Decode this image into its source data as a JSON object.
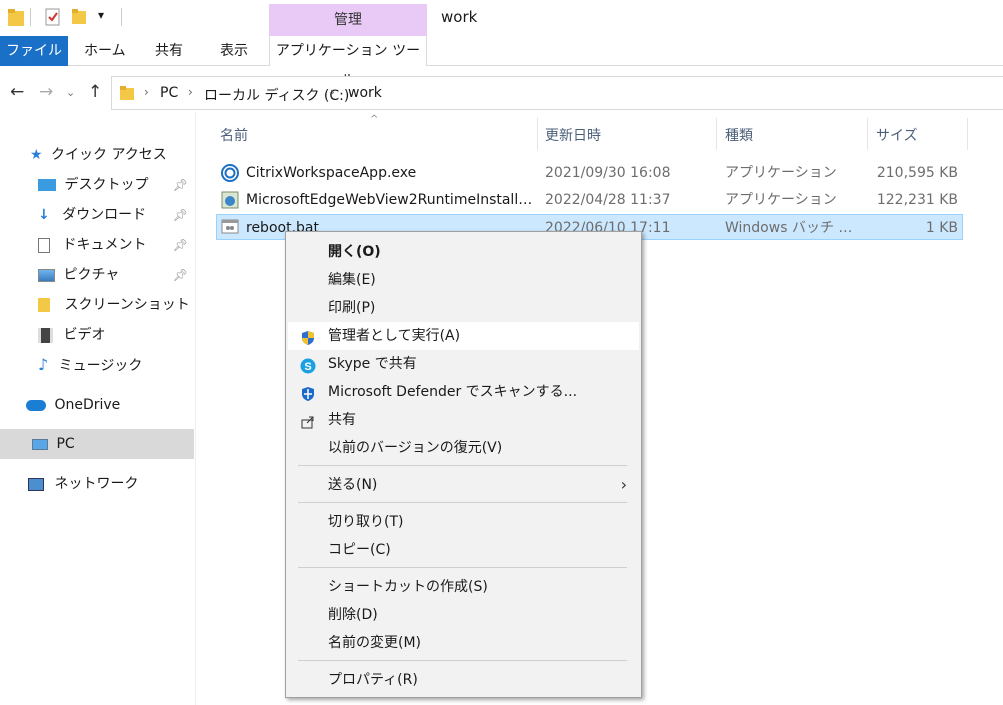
{
  "window": {
    "title": "work",
    "context_tab_header": "管理"
  },
  "ribbon": {
    "tabs": [
      {
        "label": "ファイル"
      },
      {
        "label": "ホーム"
      },
      {
        "label": "共有"
      },
      {
        "label": "表示"
      },
      {
        "label": "アプリケーション ツール"
      }
    ]
  },
  "address": {
    "crumbs": [
      "PC",
      "ローカル ディスク (C:)",
      "work"
    ]
  },
  "sidebar": {
    "items": [
      {
        "label": "クイック アクセス",
        "icon": "star-icon"
      },
      {
        "label": "デスクトップ",
        "icon": "desktop-icon",
        "pinned": true
      },
      {
        "label": "ダウンロード",
        "icon": "download-icon",
        "pinned": true
      },
      {
        "label": "ドキュメント",
        "icon": "document-icon",
        "pinned": true
      },
      {
        "label": "ピクチャ",
        "icon": "picture-icon",
        "pinned": true
      },
      {
        "label": "スクリーンショット",
        "icon": "folder-icon"
      },
      {
        "label": "ビデオ",
        "icon": "video-icon"
      },
      {
        "label": "ミュージック",
        "icon": "music-icon"
      },
      {
        "label": "OneDrive",
        "icon": "cloud-icon"
      },
      {
        "label": "PC",
        "icon": "pc-icon"
      },
      {
        "label": "ネットワーク",
        "icon": "network-icon"
      }
    ]
  },
  "filelist": {
    "columns": [
      "名前",
      "更新日時",
      "種類",
      "サイズ"
    ],
    "rows": [
      {
        "name": "CitrixWorkspaceApp.exe",
        "date": "2021/09/30 16:08",
        "type": "アプリケーション",
        "size": "210,595 KB"
      },
      {
        "name": "MicrosoftEdgeWebView2RuntimeInstalle...",
        "date": "2022/04/28 11:37",
        "type": "アプリケーション",
        "size": "122,231 KB"
      },
      {
        "name": "reboot.bat",
        "date": "2022/06/10 17:11",
        "type": "Windows バッチ ファ...",
        "size": "1 KB"
      }
    ]
  },
  "context_menu": {
    "items": [
      {
        "label": "開く(O)"
      },
      {
        "label": "編集(E)"
      },
      {
        "label": "印刷(P)"
      },
      {
        "label": "管理者として実行(A)"
      },
      {
        "label": "Skype で共有"
      },
      {
        "label": "Microsoft Defender でスキャンする..."
      },
      {
        "label": "共有"
      },
      {
        "label": "以前のバージョンの復元(V)"
      },
      {
        "label": "送る(N)"
      },
      {
        "label": "切り取り(T)"
      },
      {
        "label": "コピー(C)"
      },
      {
        "label": "ショートカットの作成(S)"
      },
      {
        "label": "削除(D)"
      },
      {
        "label": "名前の変更(M)"
      },
      {
        "label": "プロパティ(R)"
      }
    ]
  },
  "colors": {
    "accent": "#1a6fc7",
    "context_tab": "#e9c9f5",
    "selection": "#cce8ff"
  }
}
